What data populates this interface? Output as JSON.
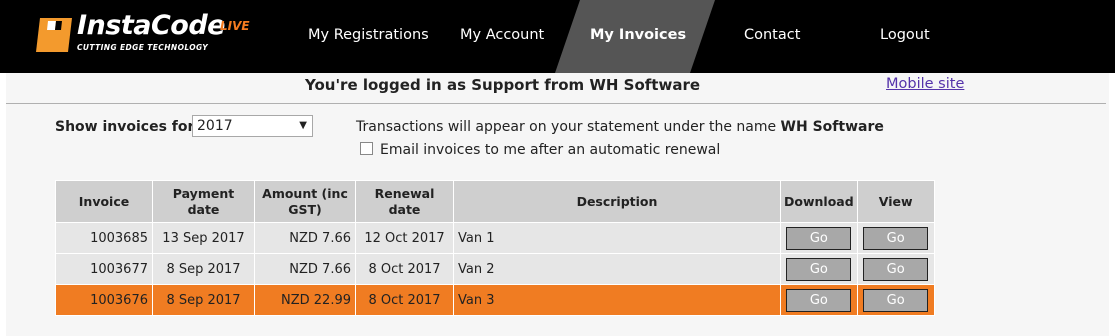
{
  "logo": {
    "name": "InstaCode",
    "live": "LIVE",
    "tagline": "CUTTING EDGE TECHNOLOGY"
  },
  "nav": {
    "registrations": "My Registrations",
    "account": "My Account",
    "invoices": "My Invoices",
    "contact": "Contact",
    "logout": "Logout"
  },
  "colors": {
    "accent": "#f07c22",
    "header_bg": "#000000",
    "active_tab": "#555555"
  },
  "login_message": "You're logged in as Support from WH Software",
  "mobile_link": "Mobile site",
  "filter": {
    "label": "Show invoices for:",
    "year": "2017"
  },
  "statement": {
    "prefix": "Transactions will appear on your statement under the name ",
    "name": "WH Software"
  },
  "email_option": {
    "label": "Email invoices to me after an automatic renewal",
    "checked": false
  },
  "table": {
    "headers": {
      "invoice": "Invoice",
      "payment_date": "Payment date",
      "amount": "Amount (inc GST)",
      "renewal_date": "Renewal date",
      "description": "Description",
      "download": "Download",
      "view": "View"
    },
    "button_label": "Go",
    "rows": [
      {
        "invoice": "1003685",
        "payment_date": "13 Sep 2017",
        "amount": "NZD 7.66",
        "renewal_date": "12 Oct 2017",
        "description": "Van 1",
        "selected": false
      },
      {
        "invoice": "1003677",
        "payment_date": "8 Sep 2017",
        "amount": "NZD 7.66",
        "renewal_date": "8 Oct 2017",
        "description": "Van 2",
        "selected": false
      },
      {
        "invoice": "1003676",
        "payment_date": "8 Sep 2017",
        "amount": "NZD 22.99",
        "renewal_date": "8 Oct 2017",
        "description": "Van 3",
        "selected": true
      }
    ]
  }
}
